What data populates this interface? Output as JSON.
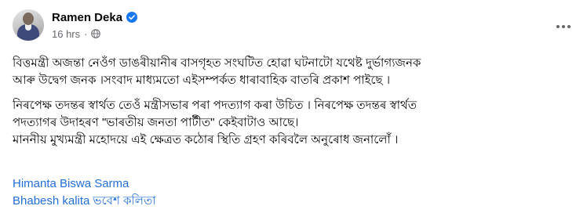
{
  "post": {
    "author": "Ramen Deka",
    "time": "16 hrs",
    "separator": "·",
    "icons": {
      "verified": "verified-badge-icon",
      "audience": "globe-icon",
      "more": "more-options-icon"
    },
    "colors": {
      "link": "#216fdb",
      "verified": "#1877f2",
      "secondary_text": "#65676b"
    },
    "paragraph1": [
      "বিত্তমন্ত্ৰী অজন্তা নেওঁগ ডাঙৰীয়ানীৰ বাসগৃহত সংঘটিত হোৱা ঘটনাটো যথেষ্ট দুৰ্ভাগ্যজনক",
      "আৰু উদ্বেগ জনক ।সংবাদ মাধ্যমতো এইসম্পৰ্কত ধাৰাবাহিক বাতৰি প্ৰকাশ পাইছে ।"
    ],
    "paragraph2": [
      "নিৰপেক্ষ তদন্তৰ স্বাৰ্থত তেওঁ মন্ত্ৰীসভাৰ পৰা পদত্যাগ কৰা উচিত । নিৰপেক্ষ তদন্তৰ স্বাৰ্থত",
      "পদত্যাগৰ উদাহৰণ \"ভাৰতীয় জনতা পাৰ্টীত\" কেইবাটাও আছে।",
      "মাননীয় মুখ্যমন্ত্ৰী মহোদয়ে এই ক্ষেত্ৰত কঠোৰ স্থিতি গ্ৰহণ কৰিবলৈ অনুৰোধ জনালোঁ ।"
    ],
    "tags": [
      "Himanta Biswa Sarma",
      "Bhabesh kalita",
      "ভবেশ কলিতা"
    ]
  }
}
